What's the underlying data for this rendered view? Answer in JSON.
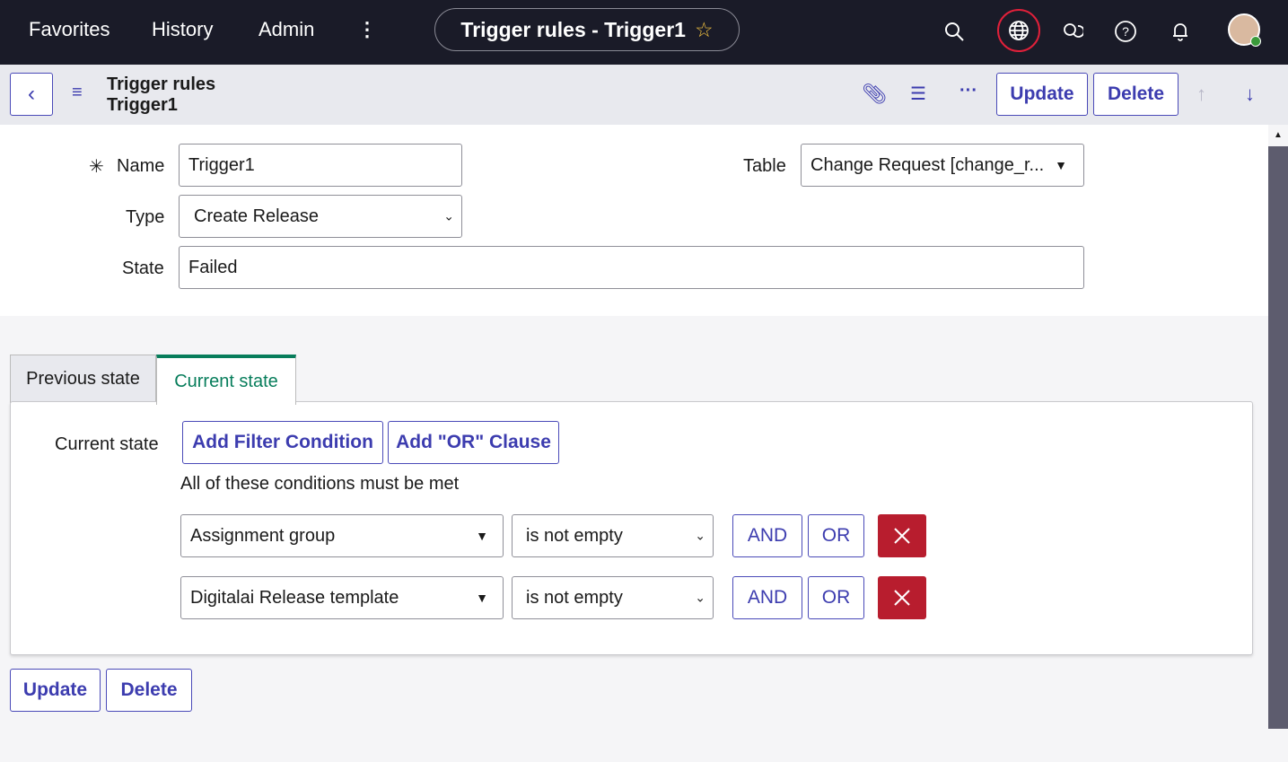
{
  "topbar": {
    "nav": [
      "Favorites",
      "History",
      "Admin"
    ],
    "title": "Trigger rules - Trigger1"
  },
  "header": {
    "breadcrumb_table": "Trigger rules",
    "breadcrumb_record": "Trigger1",
    "update": "Update",
    "delete": "Delete"
  },
  "form": {
    "name_label": "Name",
    "name_value": "Trigger1",
    "type_label": "Type",
    "type_value": "Create Release",
    "state_label": "State",
    "state_value": "Failed",
    "table_label": "Table",
    "table_value": "Change Request [change_r..."
  },
  "tabs": [
    {
      "label": "Previous state",
      "active": false
    },
    {
      "label": "Current state",
      "active": true
    }
  ],
  "filter": {
    "label": "Current state",
    "add_condition": "Add Filter Condition",
    "add_or": "Add \"OR\" Clause",
    "summary": "All of these conditions must be met",
    "conditions": [
      {
        "field": "Assignment group",
        "operator": "is not empty"
      },
      {
        "field": "Digitalai Release template",
        "operator": "is not empty"
      }
    ],
    "and": "AND",
    "or": "OR"
  },
  "footer": {
    "update": "Update",
    "delete": "Delete"
  },
  "colors": {
    "accent": "#3c3caf",
    "danger": "#b81d2e",
    "active_tab": "#077d5b",
    "topbar": "#1a1b28"
  }
}
